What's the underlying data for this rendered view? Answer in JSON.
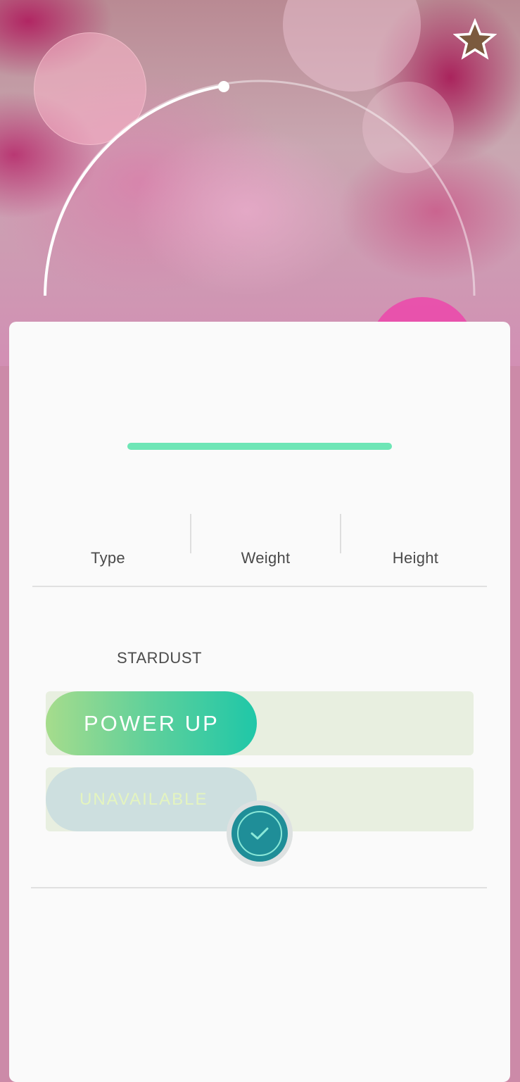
{
  "stats": {
    "type_label": "Type",
    "weight_label": "Weight",
    "height_label": "Height"
  },
  "power_up": {
    "cost_label": "STARDUST",
    "button_label": "POWER UP"
  },
  "evolve": {
    "button_label": "UNAVAILABLE"
  },
  "hp": {
    "fraction": 1.0
  },
  "colors": {
    "hp_bar": "#6ee6b6",
    "power_up_start": "#a6dc8c",
    "power_up_end": "#1fc7a8",
    "confirm_button": "#1f8e98",
    "favorite_star": "#7b5a3e"
  },
  "icons": {
    "favorite": "star-icon",
    "confirm": "check-icon"
  }
}
